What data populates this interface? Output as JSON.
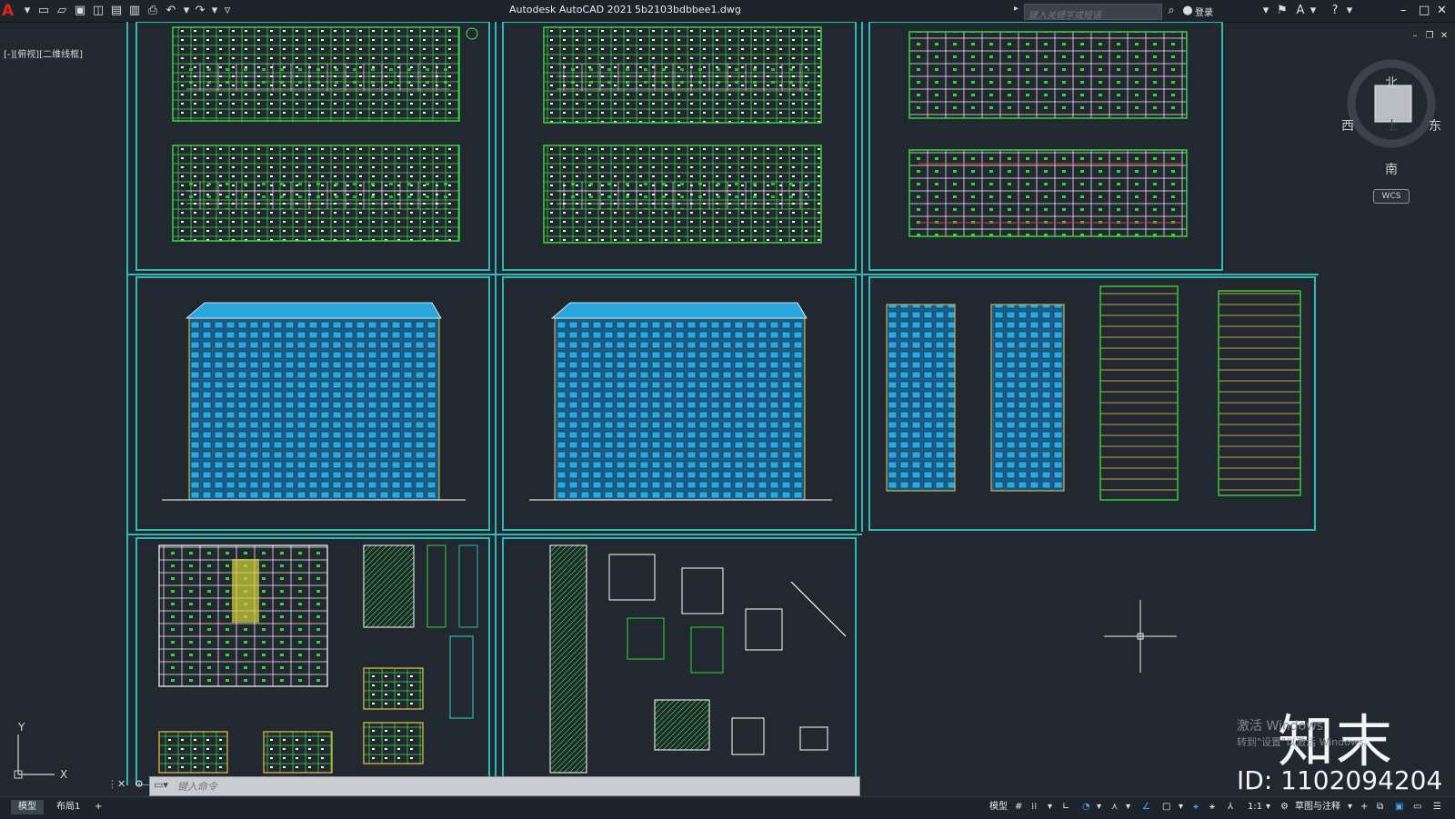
{
  "window": {
    "app_title": "Autodesk AutoCAD 2021",
    "file_name": "5b2103bdbbee1.dwg",
    "search_placeholder": "键入关键字或短语",
    "login_label": "登录",
    "help_label": "?"
  },
  "viewport": {
    "label": "[-][俯视][二维线框]"
  },
  "viewcube": {
    "north": "北",
    "south": "南",
    "east": "东",
    "west": "西",
    "face": "上",
    "wcs_label": "WCS"
  },
  "command_line": {
    "placeholder": "键入命令"
  },
  "layout_tabs": [
    {
      "label": "模型",
      "active": true
    },
    {
      "label": "布局1",
      "active": false
    },
    {
      "label": "+",
      "active": false
    }
  ],
  "status_bar": {
    "model_label": "模型",
    "scale_label": "1:1",
    "workspace_label": "草图与注释"
  },
  "watermark": {
    "activate_line1": "激活 Windows",
    "activate_line2": "转到\"设置\"以激活 Windows。",
    "brand": "知末",
    "id_text": "ID: 1102094204"
  },
  "colors": {
    "sheet_border": "#2fb9b5",
    "background": "#212830",
    "plan_green": "#39d43a",
    "facade_blue": "#1e9fd6"
  }
}
